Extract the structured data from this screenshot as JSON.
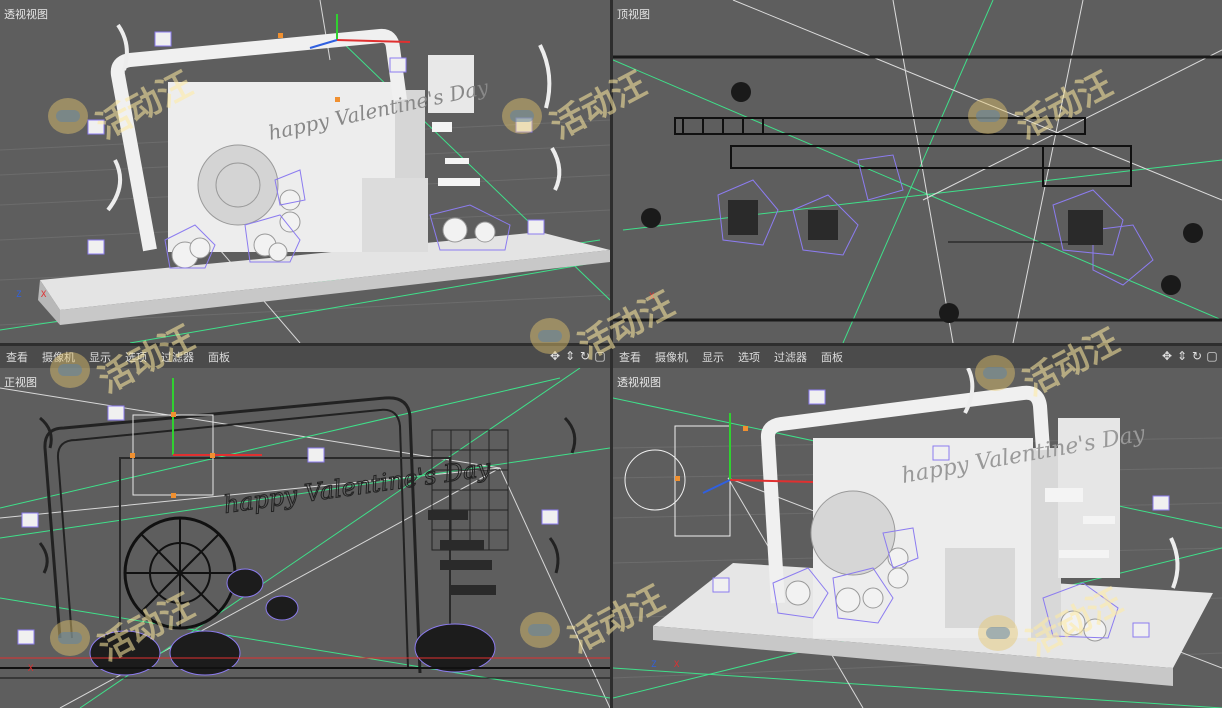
{
  "viewports": {
    "top_left": {
      "label": "透视视图"
    },
    "top_right": {
      "label": "顶视图"
    },
    "bottom_left": {
      "label": "正视图"
    },
    "bottom_right": {
      "label": "透视视图"
    }
  },
  "menu_left": [
    "查看",
    "摄像机",
    "显示",
    "选项",
    "过滤器",
    "面板"
  ],
  "menu_right": [
    "查看",
    "摄像机",
    "显示",
    "选项",
    "过滤器",
    "面板"
  ],
  "axis": {
    "x": "X",
    "y": "Y",
    "z": "Z"
  },
  "watermark": "活动汪",
  "scene_text": "happy Valentine's Day",
  "nav_icons": [
    "move-icon",
    "scale-icon",
    "rotate-icon",
    "maximize-icon"
  ],
  "colors": {
    "viewport_bg": "#5e5e5e",
    "grid": "#6c6c6c",
    "camera_line": "#3fe08a",
    "light_wire": "#8c7cf0",
    "axis_x": "#e03030",
    "axis_y": "#30d030",
    "axis_z": "#3060e0"
  }
}
